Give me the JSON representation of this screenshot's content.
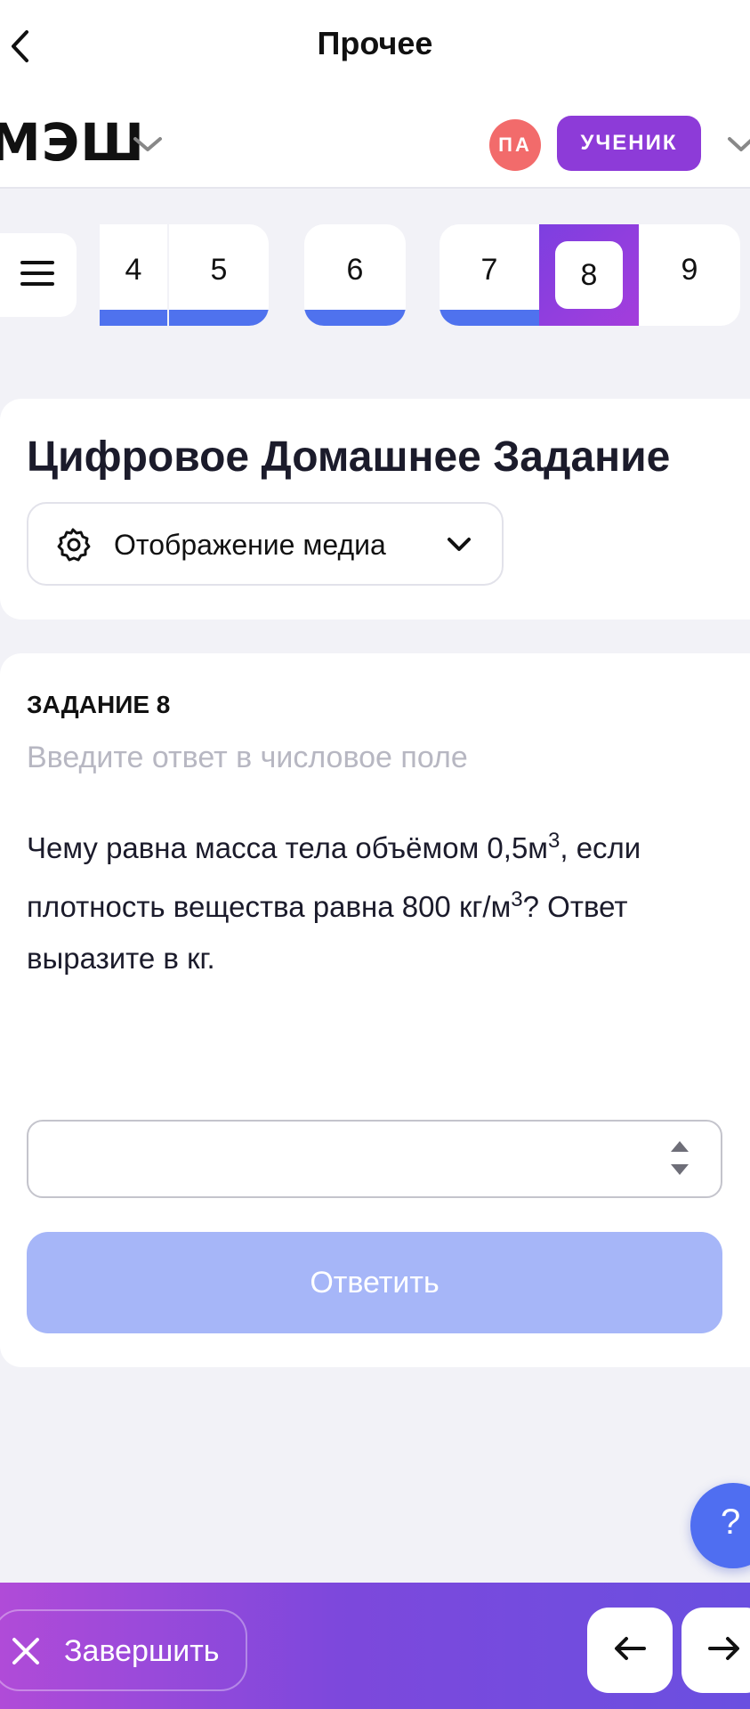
{
  "topbar": {
    "title": "Прочее"
  },
  "header": {
    "logo": "МЭШ",
    "avatar_initials": "ПА",
    "role": "УЧЕНИК",
    "avatar_color": "#f26b6b",
    "role_color": "#8d3bd8"
  },
  "tabs": [
    {
      "label": "4",
      "progress": 1
    },
    {
      "label": "5",
      "progress": 1
    },
    {
      "label": "6",
      "progress": 1
    },
    {
      "label": "7",
      "progress": 1
    },
    {
      "label": "8",
      "active": true
    },
    {
      "label": "9",
      "progress": 0
    }
  ],
  "main": {
    "title": "Цифровое Домашнее Задание",
    "media_dropdown": "Отображение медиа"
  },
  "task": {
    "label": "ЗАДАНИЕ 8",
    "hint": "Введите ответ в числовое поле",
    "q_part1": "Чему равна масса тела объёмом 0,5м",
    "q_sup1": "3",
    "q_part2": ", если плотность вещества равна 800 кг/м",
    "q_sup2": "3",
    "q_part3": "? Ответ выразите в кг.",
    "answer_value": "",
    "submit_label": "Ответить"
  },
  "help": {
    "label": "?"
  },
  "footer": {
    "finish_label": "Завершить"
  },
  "colors": {
    "accent_blue": "#4f72ee",
    "accent_purple": "#8d3bd8",
    "button_disabled": "#a6b6f8"
  }
}
